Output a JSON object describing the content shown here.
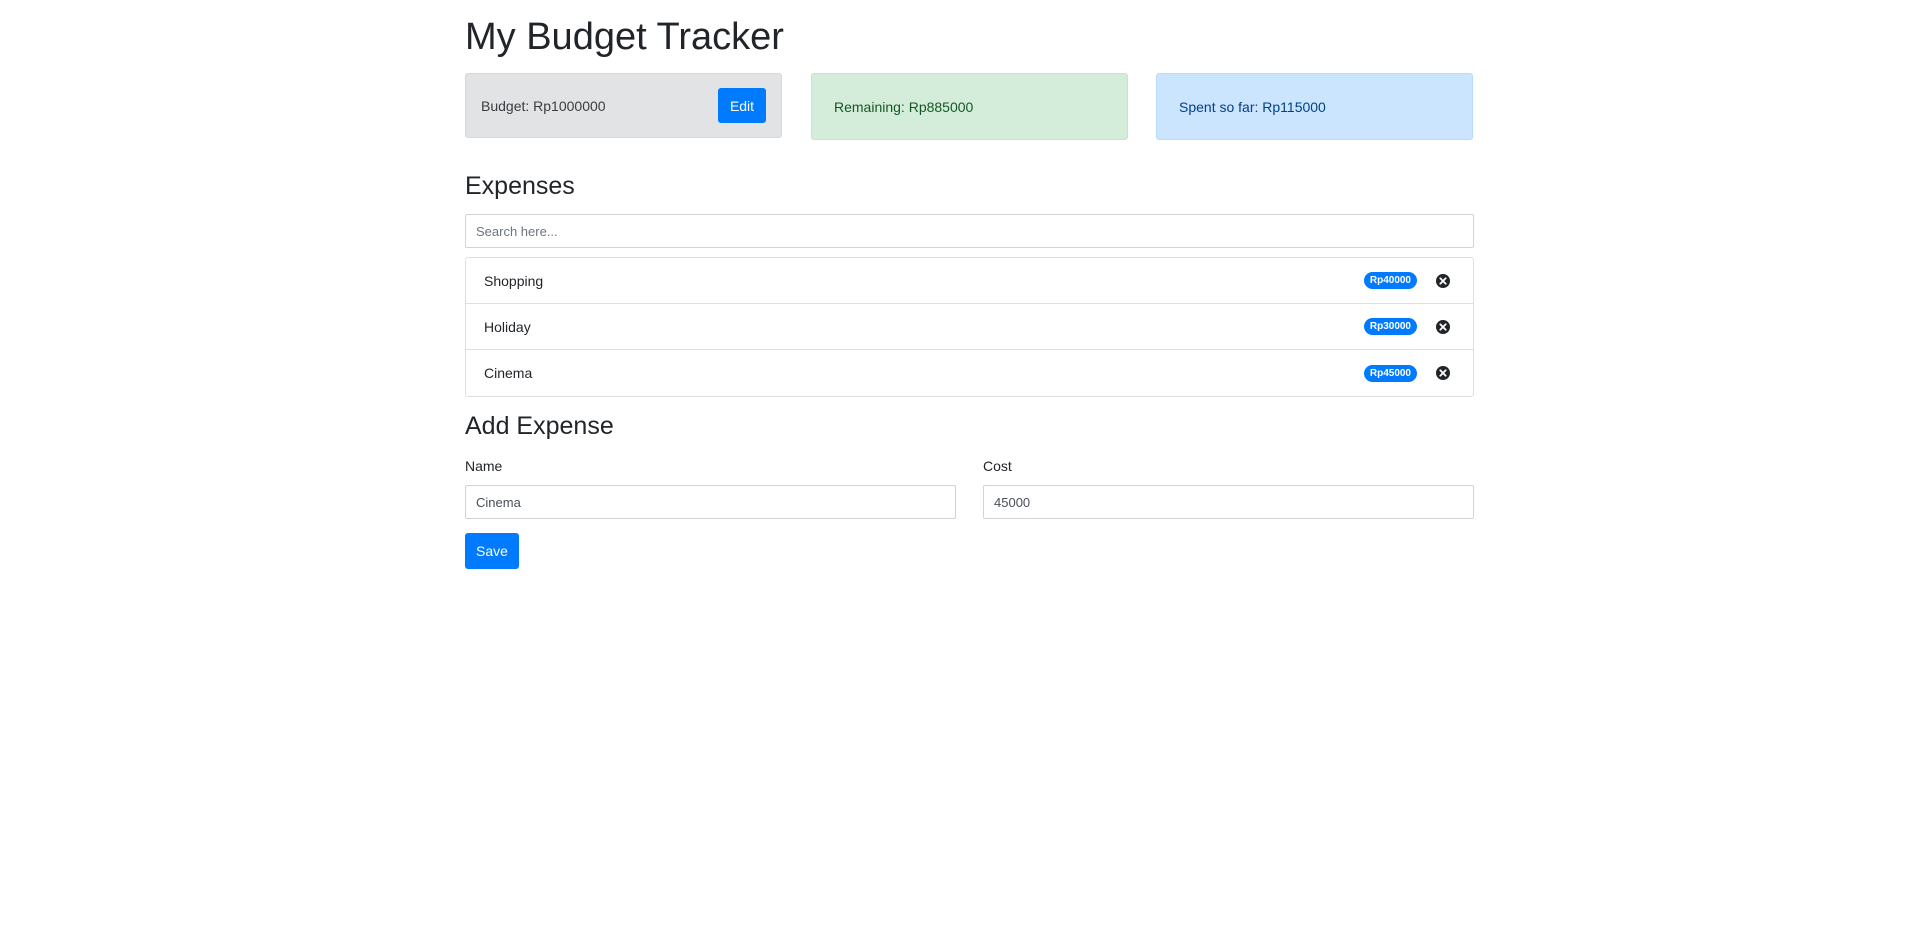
{
  "header": {
    "title": "My Budget Tracker"
  },
  "summary": {
    "budget_label": "Budget: Rp1000000",
    "edit_label": "Edit",
    "remaining_label": "Remaining: Rp885000",
    "spent_label": "Spent so far: Rp115000"
  },
  "expenses": {
    "heading": "Expenses",
    "search_placeholder": "Search here...",
    "items": [
      {
        "name": "Shopping",
        "cost": "Rp40000"
      },
      {
        "name": "Holiday",
        "cost": "Rp30000"
      },
      {
        "name": "Cinema",
        "cost": "Rp45000"
      }
    ]
  },
  "add_expense": {
    "heading": "Add Expense",
    "name_label": "Name",
    "name_value": "Cinema",
    "cost_label": "Cost",
    "cost_value": "45000",
    "save_label": "Save"
  },
  "colors": {
    "primary": "#007bff",
    "budget_bg": "#e2e3e5",
    "remaining_bg": "#d4edda",
    "spent_bg": "#cce5ff"
  },
  "icons": {
    "delete": "close-circle-icon"
  }
}
